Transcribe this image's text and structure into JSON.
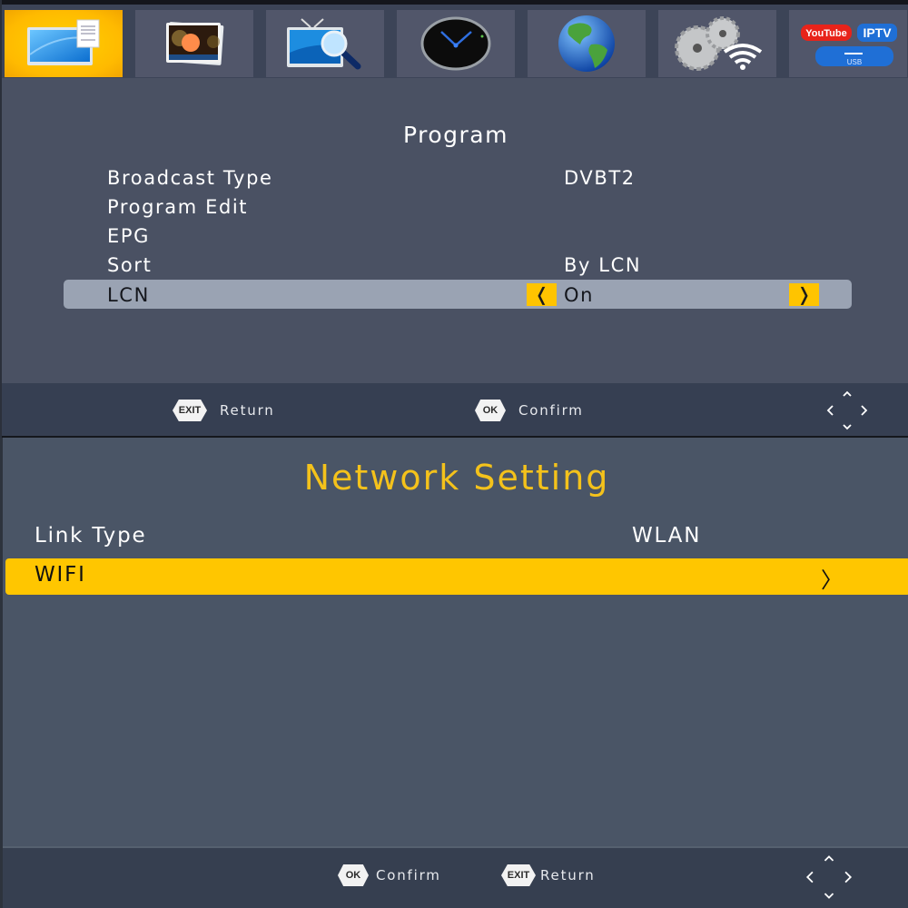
{
  "top_screen": {
    "icon_bar": [
      {
        "name": "program-icon",
        "active": true
      },
      {
        "name": "picture-icon",
        "active": false
      },
      {
        "name": "channel-search-icon",
        "active": false
      },
      {
        "name": "clock-icon",
        "active": false
      },
      {
        "name": "globe-icon",
        "active": false
      },
      {
        "name": "settings-wifi-icon",
        "active": false
      },
      {
        "name": "media-apps-icon",
        "active": false,
        "badges": [
          "YouTube",
          "IPTV",
          "USB"
        ]
      }
    ],
    "title": "Program",
    "menu": [
      {
        "label": "Broadcast Type",
        "value": "DVBT2"
      },
      {
        "label": "Program Edit",
        "value": ""
      },
      {
        "label": "EPG",
        "value": ""
      },
      {
        "label": "Sort",
        "value": "By LCN"
      },
      {
        "label": "LCN",
        "value": "On",
        "selected": true,
        "left_arrow": "❬",
        "right_arrow": "❭"
      }
    ],
    "footer": {
      "exit_key": "EXIT",
      "exit_label": "Return",
      "ok_key": "OK",
      "ok_label": "Confirm"
    }
  },
  "bottom_screen": {
    "title": "Network Setting",
    "menu": [
      {
        "label": "Link Type",
        "value": "WLAN"
      },
      {
        "label": "WIFI",
        "value": "",
        "selected": true,
        "chevron": "〉"
      }
    ],
    "footer": {
      "ok_key": "OK",
      "ok_label": "Confirm",
      "exit_key": "EXIT",
      "exit_label": "Return"
    }
  },
  "colors": {
    "accent_yellow": "#ffc400",
    "title_yellow": "#f4c21b",
    "panel_bg": "#4a5163",
    "footer_bg": "#363f52",
    "selected_row_gray": "#9aa3b3"
  }
}
